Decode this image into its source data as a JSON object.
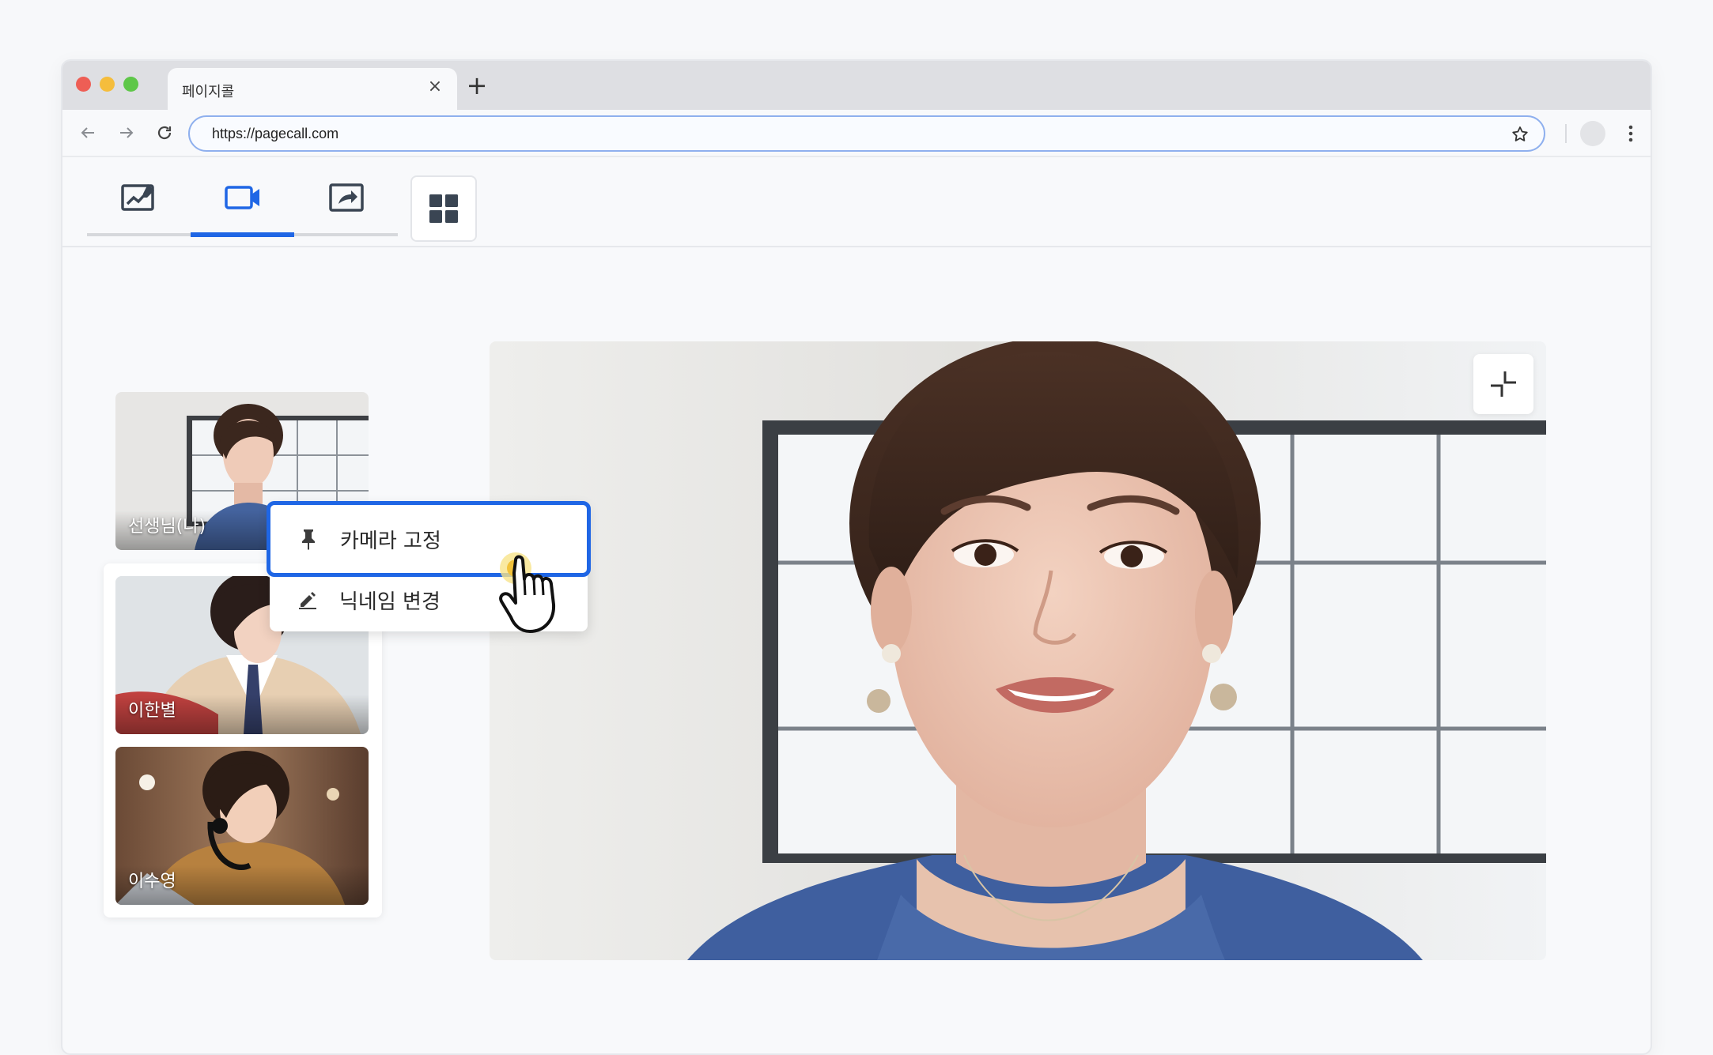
{
  "browser": {
    "tab_title": "페이지콜",
    "tab_close": "×",
    "new_tab": "+",
    "url": "https://pagecall.com"
  },
  "app_toolbar": {
    "tools": [
      {
        "name": "whiteboard-icon",
        "active": false
      },
      {
        "name": "video-camera-icon",
        "active": true
      },
      {
        "name": "screen-share-icon",
        "active": false
      }
    ],
    "layout_button": "grid-layout-icon",
    "accent_color": "#1f66e5"
  },
  "participants": [
    {
      "label": "선생님(나)"
    },
    {
      "label": "이한별"
    },
    {
      "label": "이수영"
    }
  ],
  "context_menu": {
    "items": [
      {
        "label": "카메라 고정",
        "icon": "pin-icon"
      },
      {
        "label": "닉네임 변경",
        "icon": "pencil-icon"
      }
    ]
  }
}
